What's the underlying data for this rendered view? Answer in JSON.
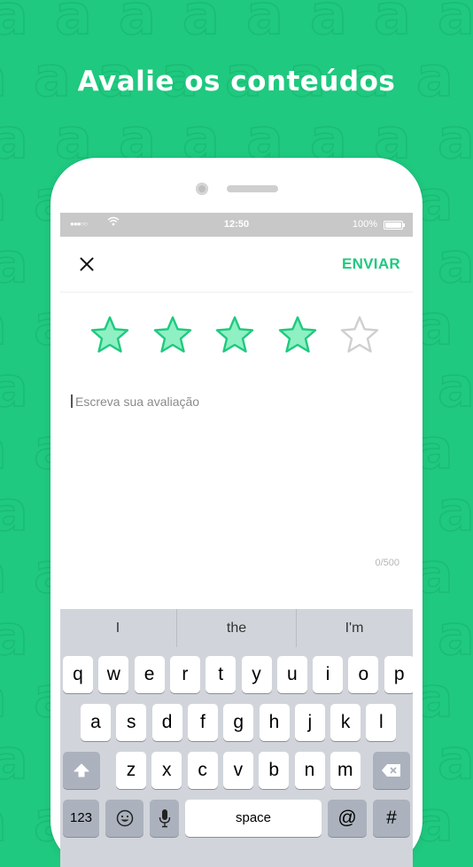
{
  "headline": "Avalie os conteúdos",
  "status_bar": {
    "signal": "●●●○○",
    "time": "12:50",
    "battery": "100%"
  },
  "nav": {
    "send_label": "ENVIAR"
  },
  "rating": {
    "value": 4,
    "max": 5,
    "filled_color": "#8ff0c3",
    "filled_stroke": "#1fc97f",
    "empty_stroke": "#cfcfcf"
  },
  "review": {
    "placeholder": "Escreva sua avaliação",
    "counter": "0/500"
  },
  "keyboard": {
    "suggestions": [
      "I",
      "the",
      "I'm"
    ],
    "row1": [
      "q",
      "w",
      "e",
      "r",
      "t",
      "y",
      "u",
      "i",
      "o",
      "p"
    ],
    "row2": [
      "a",
      "s",
      "d",
      "f",
      "g",
      "h",
      "j",
      "k",
      "l"
    ],
    "row3": [
      "z",
      "x",
      "c",
      "v",
      "b",
      "n",
      "m"
    ],
    "numbers_label": "123",
    "space_label": "space",
    "at_label": "@",
    "hash_label": "#"
  },
  "colors": {
    "brand": "#1fc97f"
  }
}
